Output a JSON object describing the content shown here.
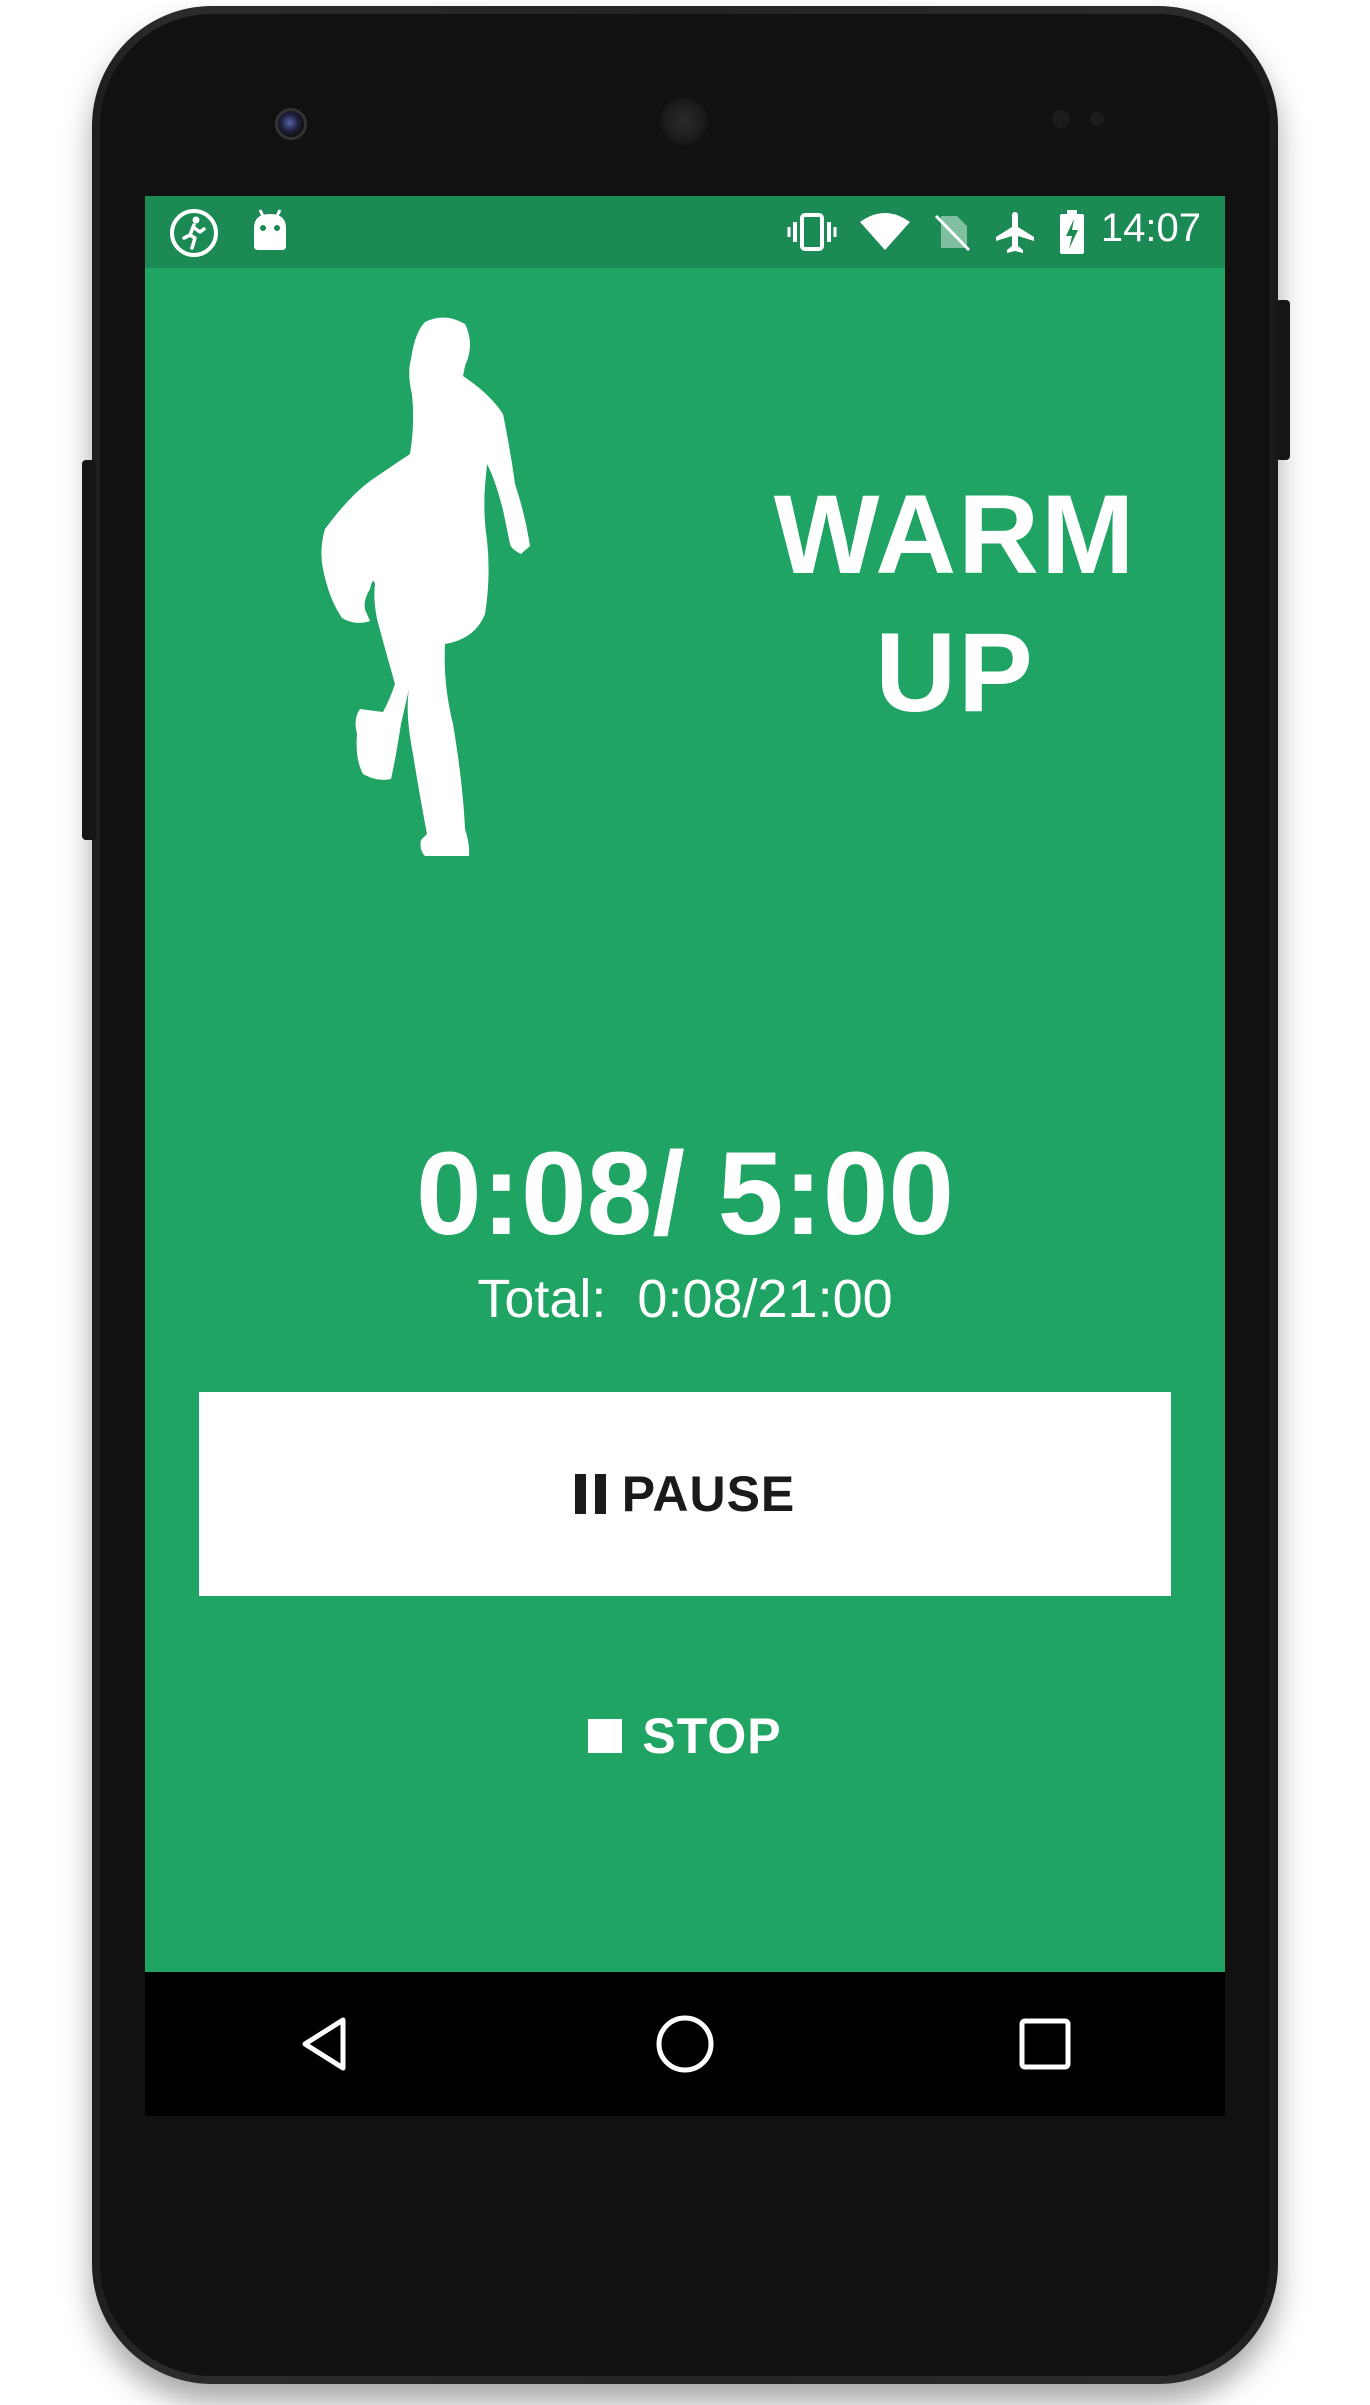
{
  "status_bar": {
    "time": "14:07",
    "left_icons": [
      "running-app-icon",
      "android-icon"
    ],
    "right_icons": [
      "vibrate-icon",
      "wifi-icon",
      "no-sim-icon",
      "airplane-icon",
      "battery-charging-icon"
    ]
  },
  "workout": {
    "phase_line1": "WARM",
    "phase_line2": "UP",
    "timer": "0:08/ 5:00",
    "total_label": "Total:",
    "total_value": "0:08/21:00"
  },
  "controls": {
    "pause_label": "PAUSE",
    "stop_label": "STOP"
  },
  "nav_bar": {
    "buttons": [
      "back-icon",
      "home-icon",
      "recents-icon"
    ]
  },
  "colors": {
    "background": "#1fa463",
    "status_bar": "#1b8a54",
    "text": "#ffffff"
  }
}
